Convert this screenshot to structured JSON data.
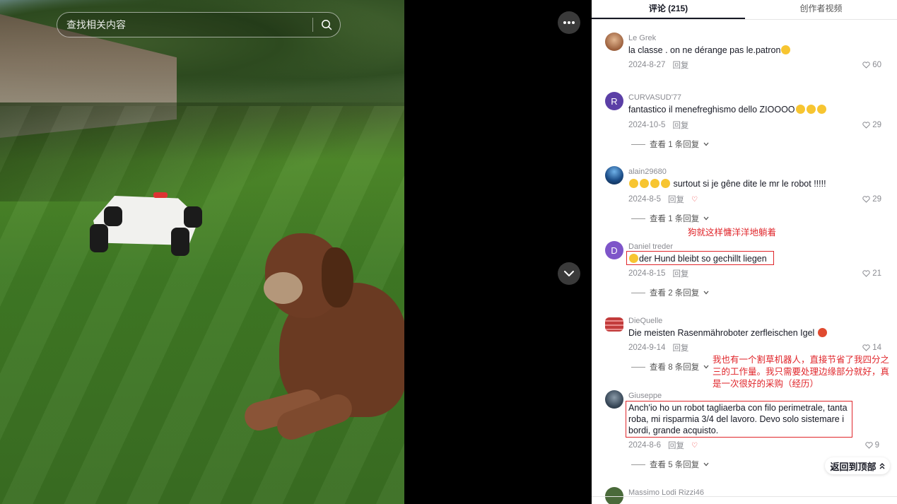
{
  "search": {
    "placeholder": "查找相关内容"
  },
  "tabs": [
    {
      "label": "评论 (215)"
    },
    {
      "label": "创作者视频"
    }
  ],
  "comments": [
    {
      "user": "Le Grek",
      "text": "la classe . on ne dérange pas le.patron",
      "date": "2024-8-27",
      "reply": "回复",
      "likes": "60",
      "avatar_color": "#b07a5a"
    },
    {
      "user": "CURVASUD'77",
      "text": "fantastico il menefreghismo dello ZIOOOO",
      "date": "2024-10-5",
      "reply": "回复",
      "likes": "29",
      "view": "查看 1 条回复",
      "avatar_letter": "R",
      "avatar_color": "#5b3fa6"
    },
    {
      "user": "alain29680",
      "text": "surtout si je gêne dite le mr le robot !!!!!",
      "date": "2024-8-5",
      "reply": "回复",
      "likes": "29",
      "view": "查看 1 条回复",
      "avatar_color": "#1d4f8a"
    },
    {
      "user": "Daniel treder",
      "text": "der Hund bleibt so gechillt liegen",
      "date": "2024-8-15",
      "reply": "回复",
      "likes": "21",
      "view": "查看 2 条回复",
      "avatar_letter": "D",
      "avatar_color": "#7e55c9"
    },
    {
      "user": "DieQuelle",
      "text": "Die meisten Rasenmähroboter zerfleischen Igel",
      "date": "2024-9-14",
      "reply": "回复",
      "likes": "14",
      "view": "查看 8 条回复",
      "avatar_color": "#c23b3b"
    },
    {
      "user": "Giuseppe",
      "text_lines": [
        "Anch'io ho un robot tagliaerba con filo perimetrale, tanta",
        "roba, mi risparmia 3/4 del lavoro. Devo solo sistemare i",
        "bordi, grande acquisto."
      ],
      "date": "2024-8-6",
      "reply": "回复",
      "likes": "9",
      "view": "查看 5 条回复",
      "avatar_color": "#3a4a5a"
    },
    {
      "user": "Massimo Lodi Rizzi46",
      "avatar_color": "#4a6a3a"
    }
  ],
  "annotations": {
    "dog_note": "狗就这样慵洋洋地躺着",
    "robot_note_lines": [
      "我也有一个割草机器人，直接节省了我四分之",
      "三的工作量。我只需要处理边缘部分就好，真",
      "是一次很好的采购（经历）"
    ]
  },
  "back_to_top": "返回到顶部",
  "icons": {
    "search": "search-icon",
    "more": "more-icon",
    "down": "chevron-down-icon",
    "heart": "heart-icon",
    "up": "double-chevron-up-icon"
  },
  "colors": {
    "annotation_red": "#e0262b",
    "text_primary": "#161823",
    "text_secondary": "#8a8b91"
  }
}
